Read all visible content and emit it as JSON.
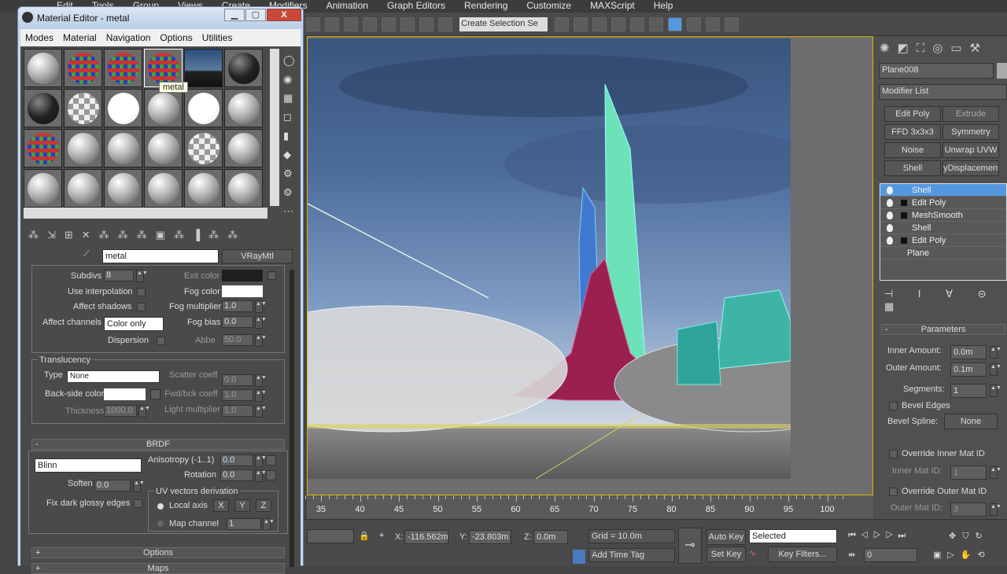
{
  "app_menu": [
    "Edit",
    "Tools",
    "Group",
    "Views",
    "Create",
    "Modifiers",
    "Animation",
    "Graph Editors",
    "Rendering",
    "Customize",
    "MAXScript",
    "Help"
  ],
  "toolbar": {
    "selection_set_placeholder": "Create Selection Se"
  },
  "material_editor": {
    "title": "Material Editor - metal",
    "menu": [
      "Modes",
      "Material",
      "Navigation",
      "Options",
      "Utilities"
    ],
    "slot_types": [
      "gray",
      "color",
      "color",
      "color",
      "sky",
      "dark",
      "dark",
      "check",
      "white",
      "gray",
      "white",
      "gray",
      "color",
      "gray",
      "gray",
      "gray",
      "check",
      "gray",
      "gray",
      "gray",
      "gray",
      "gray",
      "gray",
      "gray"
    ],
    "tooltip": "metal",
    "material_name": "metal",
    "material_type": "VRayMtl",
    "refraction": {
      "subdivs_label": "Subdivs",
      "subdivs": "8",
      "use_interpolation": "Use interpolation",
      "affect_shadows": "Affect shadows",
      "affect_channels_label": "Affect channels",
      "affect_channels": "Color only",
      "dispersion": "Dispersion",
      "exit_color": "Exit color",
      "fog_color": "Fog color",
      "fog_multiplier_label": "Fog multiplier",
      "fog_multiplier": "1.0",
      "fog_bias_label": "Fog bias",
      "fog_bias": "0.0",
      "abbe_label": "Abbe",
      "abbe": "50.0"
    },
    "translucency": {
      "title": "Translucency",
      "type_label": "Type",
      "type": "None",
      "back_side_color": "Back-side color",
      "thickness_label": "Thickness",
      "thickness": "1000.0",
      "scatter_label": "Scatter coeff",
      "scatter": "0.0",
      "fwd_label": "Fwd/bck coeff",
      "fwd": "1.0",
      "light_label": "Light multiplier",
      "light": "1.0"
    },
    "brdf": {
      "title": "BRDF",
      "collapse": "-",
      "type": "Blinn",
      "anisotropy_label": "Anisotropy (-1..1)",
      "anisotropy": "0.0",
      "rotation_label": "Rotation",
      "rotation": "0.0",
      "soften_label": "Soften",
      "soften": "0.0",
      "fix_dark": "Fix dark glossy edges",
      "uv_title": "UV vectors derivation",
      "local_axis": "Local axis",
      "x": "X",
      "y": "Y",
      "z": "Z",
      "map_channel_label": "Map channel",
      "map_channel": "1"
    },
    "rollouts": [
      {
        "sign": "+",
        "title": "Options"
      },
      {
        "sign": "+",
        "title": "Maps"
      }
    ]
  },
  "command_panel": {
    "object_name": "Plane008",
    "modifier_list": "Modifier List",
    "modifier_buttons": [
      "Edit Poly",
      "Extrude",
      "FFD 3x3x3",
      "Symmetry",
      "Noise",
      "Unwrap UVW",
      "Shell",
      "yDisplacementI"
    ],
    "stack": [
      {
        "name": "Shell",
        "plus": false,
        "bulb": true,
        "selected": true
      },
      {
        "name": "Edit Poly",
        "plus": true,
        "bulb": true
      },
      {
        "name": "MeshSmooth",
        "plus": true,
        "bulb": true
      },
      {
        "name": "Shell",
        "plus": false,
        "bulb": true
      },
      {
        "name": "Edit Poly",
        "plus": true,
        "bulb": true
      },
      {
        "name": "Plane",
        "plus": false,
        "bulb": false
      }
    ],
    "parameters": {
      "title": "Parameters",
      "collapse": "-",
      "inner_label": "Inner Amount:",
      "inner": "0.0m",
      "outer_label": "Outer Amount:",
      "outer": "0.1m",
      "segments_label": "Segments:",
      "segments": "1",
      "bevel_edges": "Bevel Edges",
      "bevel_spline_label": "Bevel Spline:",
      "bevel_spline": "None",
      "override_inner": "Override Inner Mat ID",
      "inner_mat_label": "Inner Mat ID:",
      "inner_mat": "1",
      "override_outer": "Override Outer Mat ID",
      "outer_mat_label": "Outer Mat ID:",
      "outer_mat": "3"
    }
  },
  "timeline": {
    "labels": [
      "35",
      "40",
      "45",
      "50",
      "55",
      "60",
      "65",
      "70",
      "75",
      "80",
      "85",
      "90",
      "95",
      "100"
    ]
  },
  "status": {
    "x_label": "X:",
    "x": "-116.562m",
    "y_label": "Y:",
    "y": "-23.803m",
    "z_label": "Z:",
    "z": "0.0m",
    "grid": "Grid = 10.0m",
    "add_time_tag": "Add Time Tag",
    "auto_key": "Auto Key",
    "set_key": "Set Key",
    "selected": "Selected",
    "key_filters": "Key Filters...",
    "frame": "0"
  },
  "colors": {
    "accent_selection": "#5698e0",
    "viewport_border": "#d8b700",
    "panel": "#4a4a4a"
  }
}
